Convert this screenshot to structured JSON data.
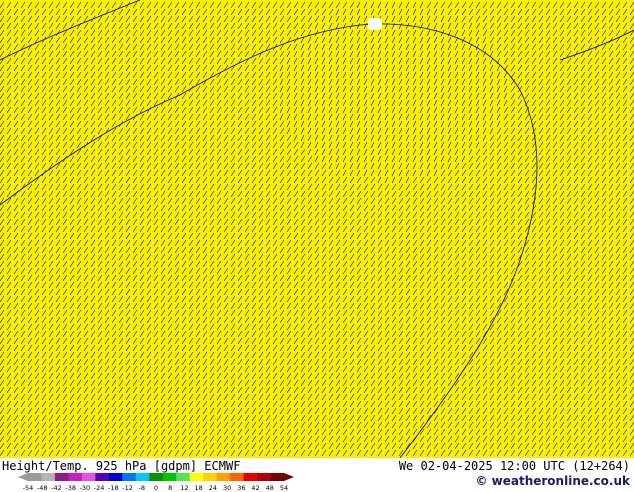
{
  "map": {
    "title": "Height/Temp. 925 hPa [gdpm] ECMWF",
    "valid_time": "We 02-04-2025 12:00 UTC (12+264)",
    "credit": "© weatheronline.co.uk",
    "background_color": "#f8f000",
    "wind_barb_values_shown": [
      "1",
      "2",
      "3",
      "4",
      "5"
    ],
    "colorbar": {
      "ticks": [
        "-54",
        "-48",
        "-42",
        "-38",
        "-30",
        "-24",
        "-18",
        "-12",
        "-8",
        "0",
        "8",
        "12",
        "18",
        "24",
        "30",
        "36",
        "42",
        "48",
        "54"
      ],
      "colors": [
        "#9a9a9a",
        "#b4b4b4",
        "#8c1e8c",
        "#c81ec8",
        "#e650e6",
        "#5a00b4",
        "#0000dc",
        "#0078f0",
        "#00c8ff",
        "#009600",
        "#00c800",
        "#50e650",
        "#ffff00",
        "#ffd200",
        "#ffa000",
        "#ff6400",
        "#e60000",
        "#b40000",
        "#780000"
      ]
    }
  }
}
